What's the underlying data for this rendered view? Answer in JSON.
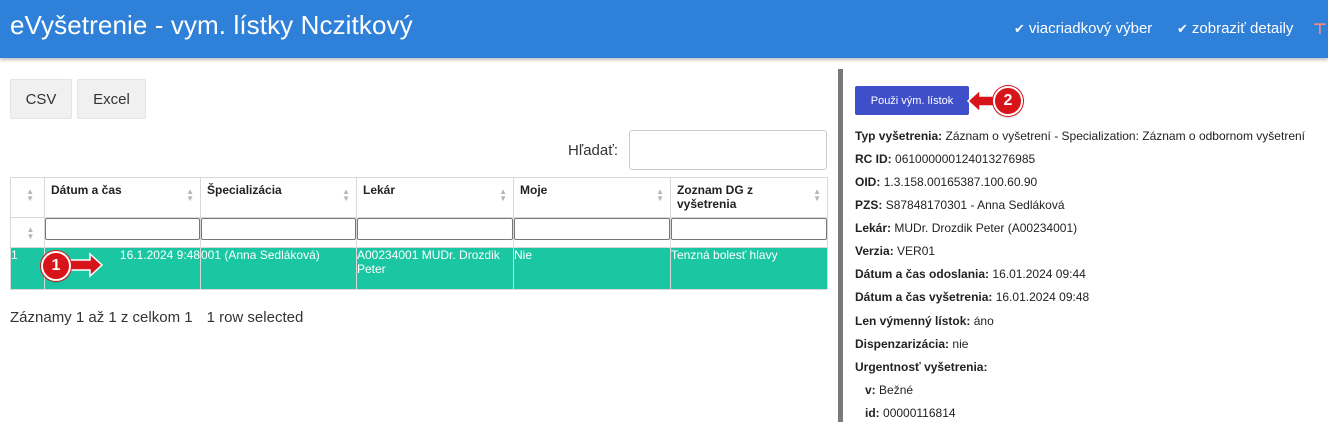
{
  "header": {
    "title": "eVyšetrenie - vym. lístky Nczitkový",
    "options": [
      {
        "label": "viacriadkový výber",
        "checked": true
      },
      {
        "label": "zobraziť detaily",
        "checked": true
      }
    ],
    "extra_icon": "filter-icon"
  },
  "toolbar": {
    "csv_label": "CSV",
    "excel_label": "Excel"
  },
  "search": {
    "label": "Hľadať:",
    "value": ""
  },
  "table": {
    "columns": [
      "",
      "Dátum a čas",
      "Špecializácia",
      "Lekár",
      "Moje",
      "Zoznam DG z vyšetrenia"
    ],
    "rows": [
      {
        "index": "1",
        "datetime": "16.1.2024 9:48",
        "specialization": "001 (Anna Sedláková)",
        "doctor": "A00234001 MUDr. Drozdik Peter",
        "mine": "Nie",
        "diagnoses": "Tenzná bolesť hlavy",
        "selected": true
      }
    ]
  },
  "footer": {
    "records_text": "Záznamy 1 až 1 z celkom 1",
    "selection_text": "1 row selected"
  },
  "detail_panel": {
    "use_button_label": "Použi vým. lístok",
    "fields": [
      {
        "label": "Typ vyšetrenia:",
        "value": "Záznam o vyšetrení - Specialization: Záznam o odbornom vyšetrení"
      },
      {
        "label": "RC ID:",
        "value": "061000000124013276985"
      },
      {
        "label": "OID:",
        "value": "1.3.158.00165387.100.60.90"
      },
      {
        "label": "PZS:",
        "value": "S87848170301 - Anna Sedláková"
      },
      {
        "label": "Lekár:",
        "value": "MUDr. Drozdik Peter (A00234001)"
      },
      {
        "label": "Verzia:",
        "value": "VER01"
      },
      {
        "label": "Dátum a čas odoslania:",
        "value": "16.01.2024 09:44"
      },
      {
        "label": "Dátum a čas vyšetrenia:",
        "value": "16.01.2024 09:48"
      },
      {
        "label": "Len výmenný lístok:",
        "value": "áno"
      },
      {
        "label": "Dispenzarizácia:",
        "value": "nie"
      },
      {
        "label": "Urgentnosť vyšetrenia:",
        "value": ""
      },
      {
        "label": "v:",
        "value": "Bežné"
      },
      {
        "label": "id:",
        "value": "00000116814"
      }
    ]
  },
  "annotations": {
    "marker1": "1",
    "marker2": "2"
  },
  "colors": {
    "header_bg": "#2f80d8",
    "selected_row": "#1bc7a3",
    "use_button": "#3f4fc9",
    "marker": "#d7141a"
  }
}
